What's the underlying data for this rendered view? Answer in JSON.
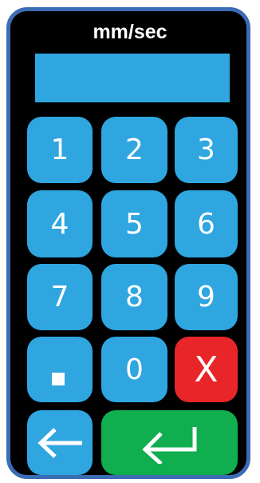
{
  "keypad": {
    "title": "mm/sec",
    "display_value": "",
    "keys": {
      "one": "1",
      "two": "2",
      "three": "3",
      "four": "4",
      "five": "5",
      "six": "6",
      "seven": "7",
      "eight": "8",
      "nine": "9",
      "zero": "0",
      "cancel": "X"
    },
    "icons": {
      "decimal": "decimal-point-icon",
      "backspace": "arrow-left-icon",
      "enter": "enter-icon"
    },
    "colors": {
      "frame": "#3b6db5",
      "key": "#2fa6e0",
      "cancel": "#e82528",
      "enter": "#10ae4e",
      "background": "#000000"
    }
  }
}
